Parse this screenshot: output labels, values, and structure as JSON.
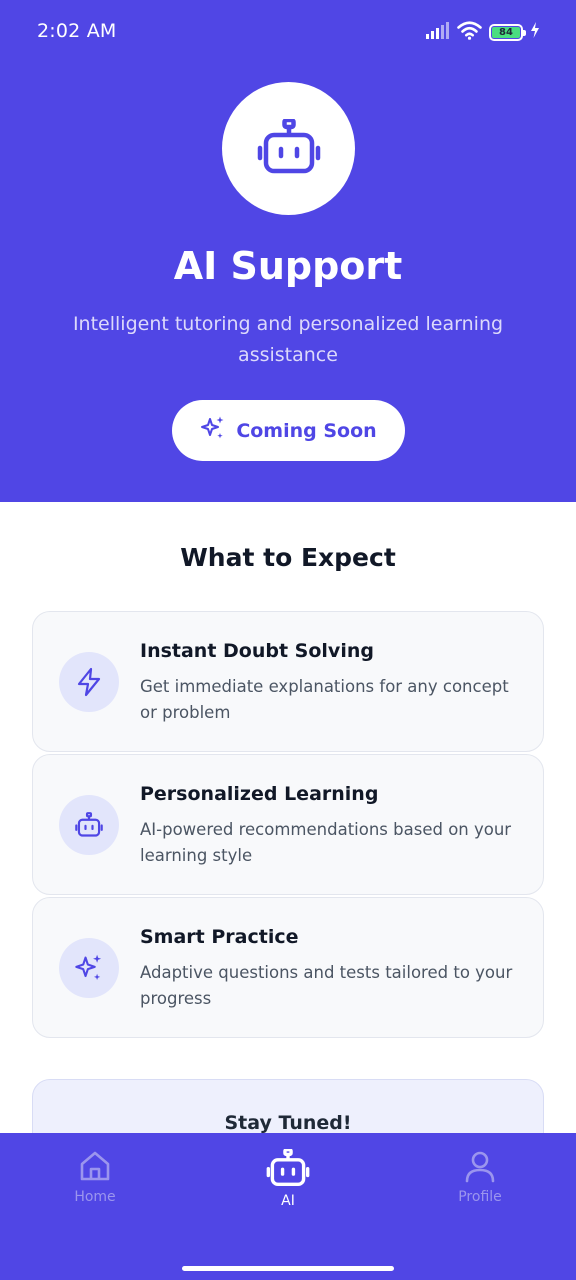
{
  "status_bar": {
    "time": "2:02 AM",
    "battery_level": "84",
    "icons": [
      "signal-icon",
      "wifi-icon",
      "battery-icon",
      "charging-icon"
    ]
  },
  "hero": {
    "icon": "robot-icon",
    "title": "AI Support",
    "subtitle": "Intelligent tutoring and personalized learning assistance",
    "button_label": "Coming Soon",
    "button_icon": "sparkles-icon"
  },
  "expect": {
    "title": "What to Expect",
    "features": [
      {
        "icon": "lightning-icon",
        "title": "Instant Doubt Solving",
        "description": "Get immediate explanations for any concept or problem"
      },
      {
        "icon": "robot-icon",
        "title": "Personalized Learning",
        "description": "AI-powered recommendations based on your learning style"
      },
      {
        "icon": "sparkles-icon",
        "title": "Smart Practice",
        "description": "Adaptive questions and tests tailored to your progress"
      }
    ]
  },
  "stay_tuned": {
    "title": "Stay Tuned!"
  },
  "bottom_nav": {
    "items": [
      {
        "label": "Home",
        "icon": "home-icon",
        "active": false
      },
      {
        "label": "AI",
        "icon": "robot-icon",
        "active": true
      },
      {
        "label": "Profile",
        "icon": "user-icon",
        "active": false
      }
    ]
  },
  "colors": {
    "primary": "#5046e5",
    "accent": "#4f46e5",
    "card_bg": "#f8f9fb",
    "icon_bg": "#e2e5fb",
    "battery": "#4ade80"
  }
}
